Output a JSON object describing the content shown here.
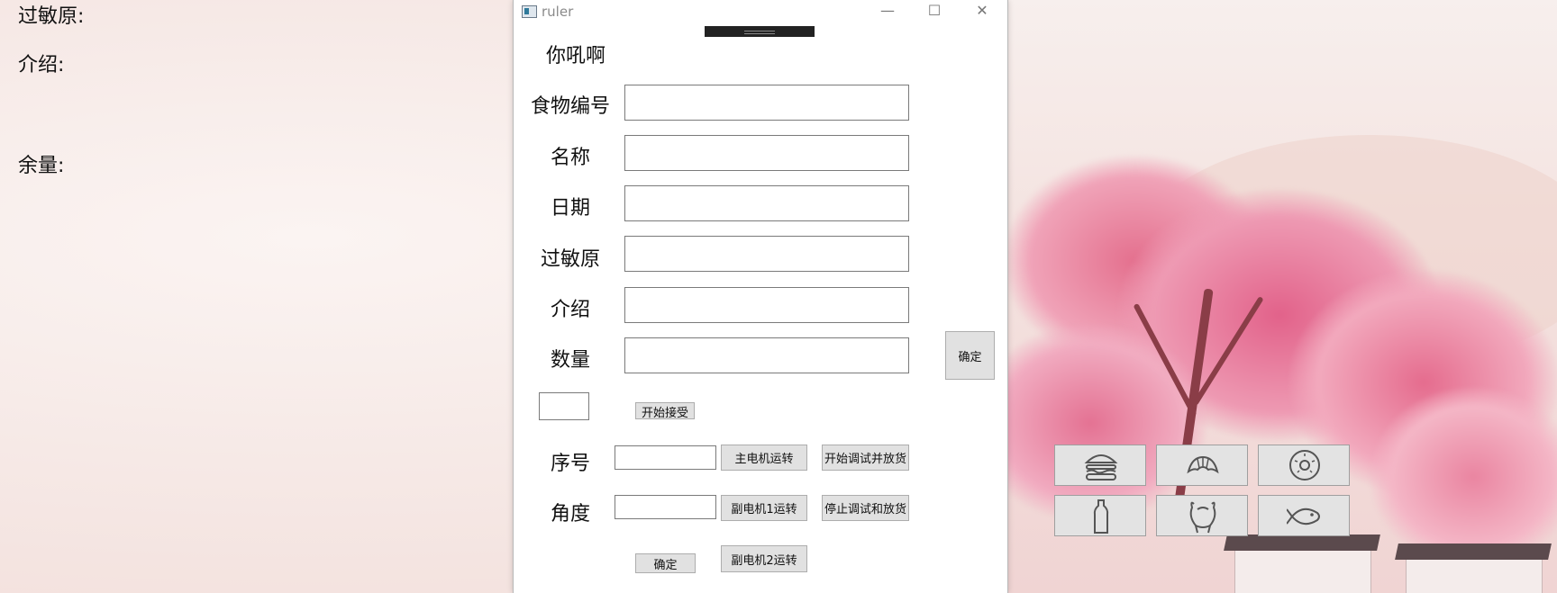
{
  "left_panel": {
    "allergen_label": "过敏原:",
    "intro_label": "介绍:",
    "remaining_label": "余量:"
  },
  "window": {
    "title": "ruler",
    "heading": "你吼啊",
    "fields": {
      "food_id_label": "食物编号",
      "name_label": "名称",
      "date_label": "日期",
      "allergen_label": "过敏原",
      "intro_label": "介绍",
      "quantity_label": "数量",
      "serial_label": "序号",
      "angle_label": "角度"
    },
    "buttons": {
      "confirm_side": "确定",
      "start_receive": "开始接受",
      "main_motor_run": "主电机运转",
      "start_debug_dispense": "开始调试并放货",
      "sub_motor1_run": "副电机1运转",
      "stop_debug_dispense": "停止调试和放货",
      "confirm_bottom": "确定",
      "sub_motor2_run": "副电机2运转"
    }
  },
  "food_icons": [
    "burger-icon",
    "croissant-icon",
    "donut-icon",
    "bottle-icon",
    "chicken-icon",
    "fish-icon"
  ]
}
